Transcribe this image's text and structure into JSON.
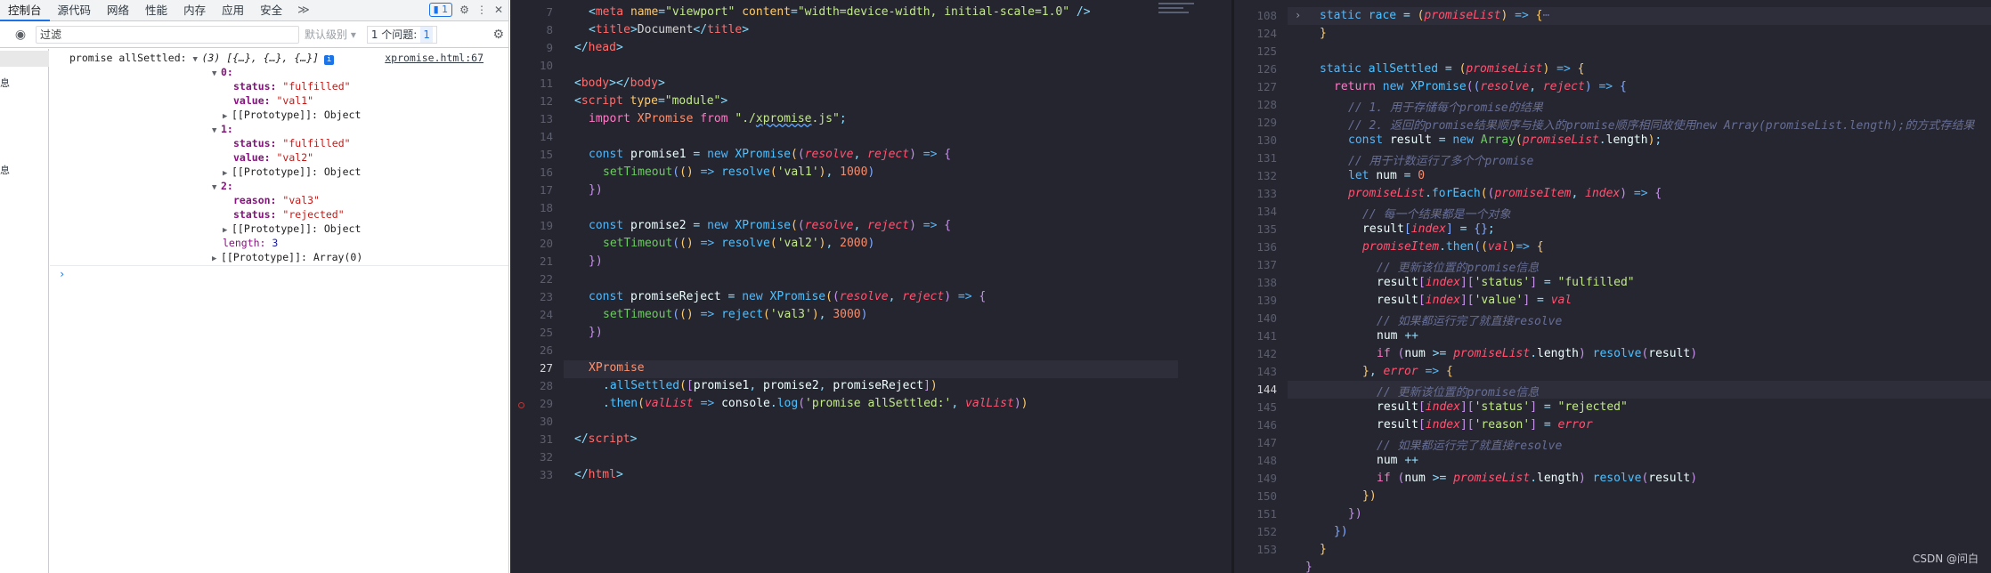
{
  "devtools": {
    "tabs": [
      "控制台",
      "源代码",
      "网络",
      "性能",
      "内存",
      "应用",
      "安全"
    ],
    "more": "≫",
    "badge": "1",
    "filter_placeholder": "过滤",
    "level": "默认级别 ▾",
    "issues_label": "1 个问题:",
    "issues_count": "1",
    "sidebar_items": [
      "息",
      "息"
    ],
    "console": {
      "log_label": "promise allSettled:",
      "log_summary": "(3) [{…}, {…}, {…}]",
      "source_link": "xpromise.html:67",
      "entries": [
        {
          "index": "0:",
          "fields": [
            [
              "status",
              "\"fulfilled\""
            ],
            [
              "value",
              "\"val1\""
            ]
          ]
        },
        {
          "index": "1:",
          "fields": [
            [
              "status",
              "\"fulfilled\""
            ],
            [
              "value",
              "\"val2\""
            ]
          ]
        },
        {
          "index": "2:",
          "fields": [
            [
              "reason",
              "\"val3\""
            ],
            [
              "status",
              "\"rejected\""
            ]
          ]
        }
      ],
      "proto_object": "[[Prototype]]: Object",
      "length_label": "length:",
      "length_value": "3",
      "proto_array": "[[Prototype]]: Array(0)"
    }
  },
  "editor_left": {
    "line_numbers": [
      "7",
      "8",
      "9",
      "10",
      "11",
      "12",
      "13",
      "14",
      "15",
      "16",
      "17",
      "18",
      "19",
      "20",
      "21",
      "22",
      "23",
      "24",
      "25",
      "26",
      "27",
      "28",
      "29",
      "30",
      "31",
      "32",
      "33"
    ],
    "current_line": "27"
  },
  "editor_right": {
    "line_numbers": [
      "108",
      "124",
      "125",
      "126",
      "127",
      "128",
      "129",
      "130",
      "131",
      "132",
      "133",
      "134",
      "135",
      "136",
      "137",
      "138",
      "139",
      "140",
      "141",
      "142",
      "143",
      "144",
      "145",
      "146",
      "147",
      "148",
      "149",
      "150",
      "151",
      "152",
      "153"
    ],
    "current_line": "144",
    "comments": {
      "c128": "// 1. 用于存储每个promise的结果",
      "c129": "// 2. 返回的promise结果顺序与接入的promise顺序相同故使用new Array(promiseList.length);的方式存结果",
      "c131": "// 用于计数运行了多个个promise",
      "c134": "// 每一个结果都是一个对象",
      "c137": "// 更新该位置的promise信息",
      "c140": "// 如果都运行完了就直接resolve",
      "c144": "// 更新该位置的promise信息",
      "c147": "// 如果都运行完了就直接resolve"
    },
    "watermark": "CSDN @问白"
  }
}
